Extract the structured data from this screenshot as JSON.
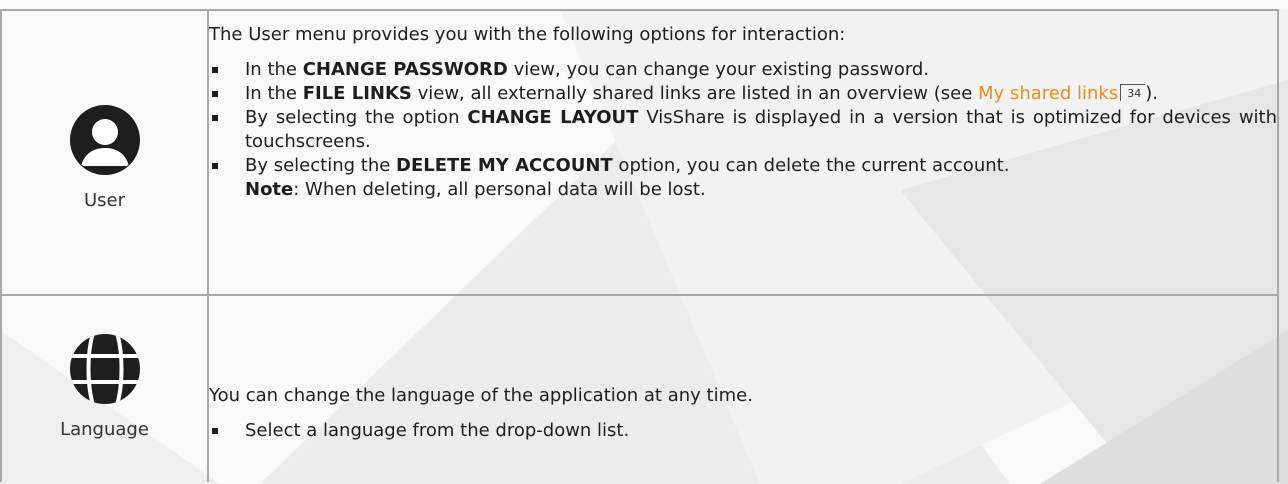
{
  "rows": {
    "user": {
      "icon": "user-avatar-icon",
      "label": "User",
      "intro": "The User menu provides you with the following options for interaction:",
      "items": [
        {
          "pre": "In the ",
          "bold": "CHANGE PASSWORD",
          "post": " view, you can change your existing password."
        },
        {
          "pre": "In the ",
          "bold": "FILE LINKS",
          "post": " view, all externally shared links are listed in an overview (see ",
          "link": "My shared links",
          "ref": "34",
          "tail": ")."
        },
        {
          "pre": "By selecting the option ",
          "bold": "CHANGE LAYOUT",
          "post": " VisShare is displayed in a version that is optimized for devices with touchscreens."
        },
        {
          "pre": "By selecting the ",
          "bold": "DELETE MY ACCOUNT",
          "post": " option, you can delete the current account.",
          "note_bold": "Note",
          "note_text": ": When deleting, all personal data will be lost."
        }
      ]
    },
    "language": {
      "icon": "globe-icon",
      "label": "Language",
      "intro": "You can change the language of the application at any time.",
      "items": [
        {
          "text": "Select a language from the drop-down list."
        }
      ]
    }
  },
  "colors": {
    "link": "#e98c21",
    "border": "#a8a8a8",
    "icon": "#1e1e1e"
  }
}
